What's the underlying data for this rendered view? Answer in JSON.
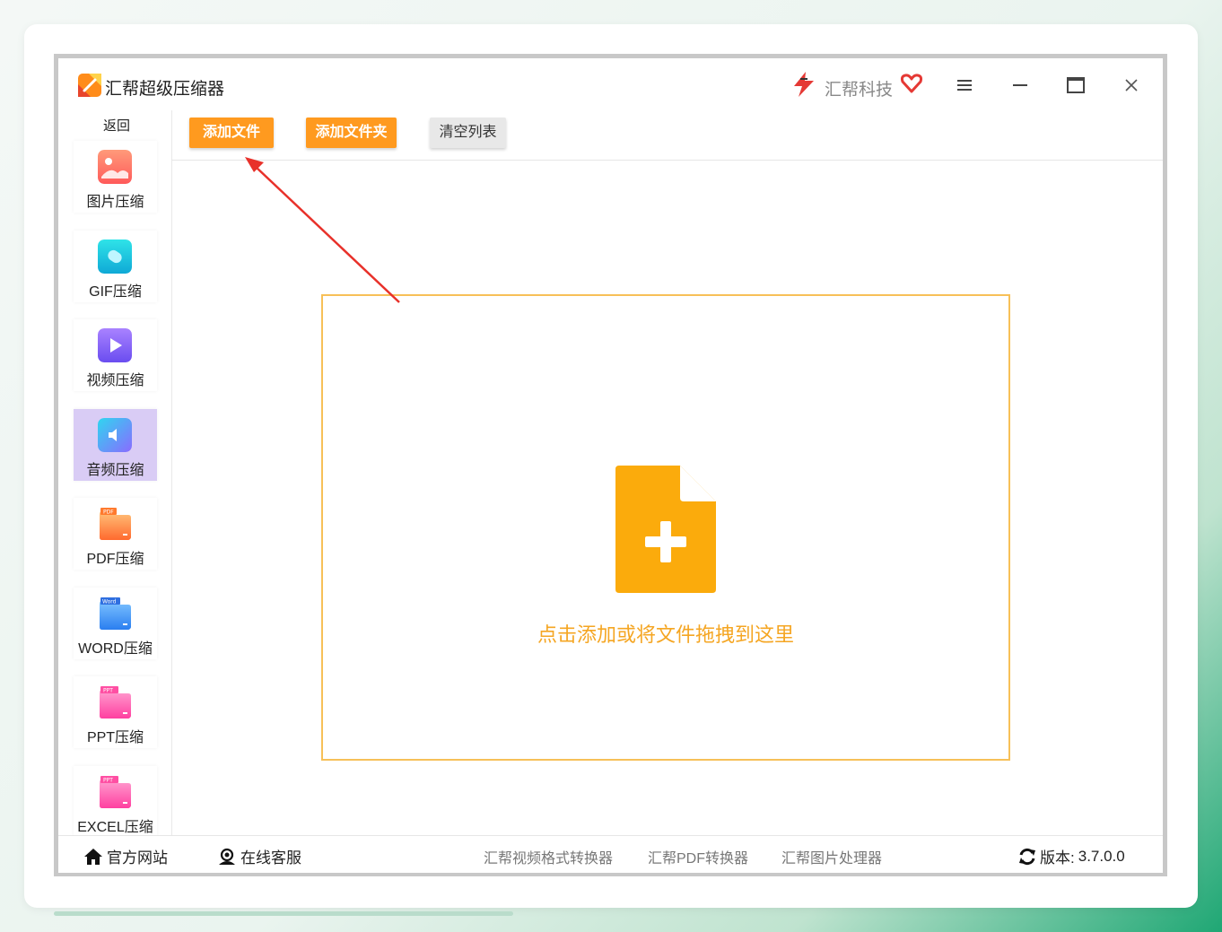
{
  "app": {
    "title": "汇帮超级压缩器",
    "brand": "汇帮科技"
  },
  "sidebar": {
    "back_label": "返回",
    "items": [
      {
        "label": "图片压缩",
        "icon": "image-compress-icon",
        "color": "#ff6f61"
      },
      {
        "label": "GIF压缩",
        "icon": "gif-compress-icon",
        "color": "#19c3d6"
      },
      {
        "label": "视频压缩",
        "icon": "video-compress-icon",
        "color": "#8a5cf6"
      },
      {
        "label": "音频压缩",
        "icon": "audio-compress-icon",
        "color": "#6b8cff",
        "active": true
      },
      {
        "label": "PDF压缩",
        "icon": "pdf-compress-icon",
        "color": "#ff7a2e"
      },
      {
        "label": "WORD压缩",
        "icon": "word-compress-icon",
        "color": "#2f8cf0"
      },
      {
        "label": "PPT压缩",
        "icon": "ppt-compress-icon",
        "color": "#ff4fa3"
      },
      {
        "label": "EXCEL压缩",
        "icon": "excel-compress-icon",
        "color": "#ff4fa3"
      }
    ]
  },
  "toolbar": {
    "add_file": "添加文件",
    "add_folder": "添加文件夹",
    "clear_list": "清空列表"
  },
  "dropzone": {
    "text": "点击添加或将文件拖拽到这里"
  },
  "footer": {
    "official_site": "官方网站",
    "online_service": "在线客服",
    "links": [
      "汇帮视频格式转换器",
      "汇帮PDF转换器",
      "汇帮图片处理器"
    ],
    "version_label": "版本:",
    "version": "3.7.0.0"
  },
  "colors": {
    "accent": "#ff9a1f",
    "dropzone_border": "#f7c058",
    "active_item": "#d9ccf5"
  }
}
